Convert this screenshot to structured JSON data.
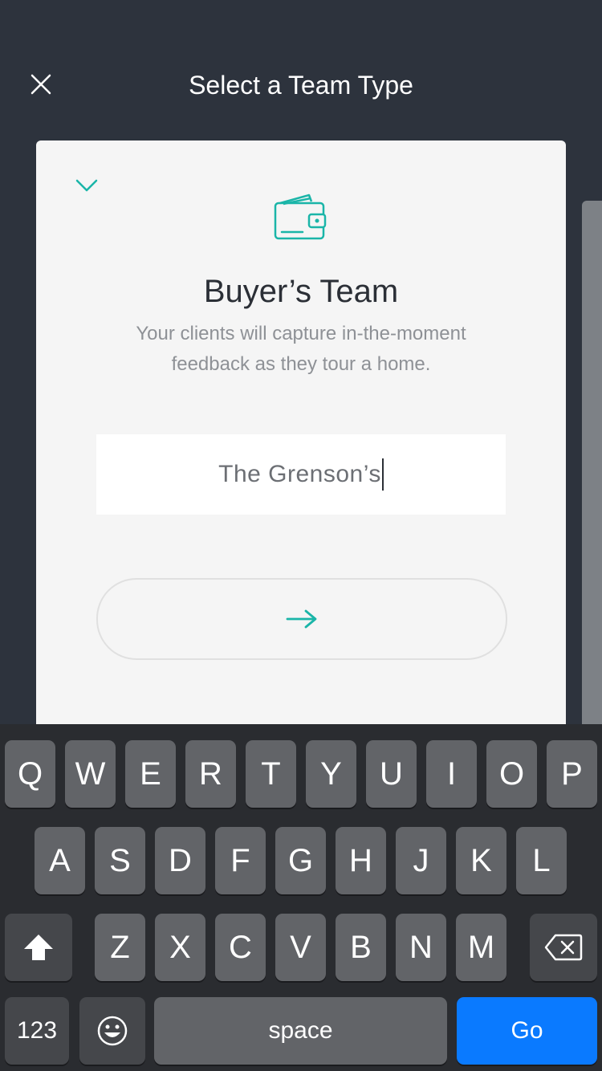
{
  "header": {
    "title": "Select a Team Type"
  },
  "card": {
    "title": "Buyer’s Team",
    "description": "Your clients will capture in-the-moment feedback as they tour a home.",
    "name_input_value": "The Grenson’s",
    "accent_color": "#1ab5a8"
  },
  "keyboard": {
    "row1": [
      "Q",
      "W",
      "E",
      "R",
      "T",
      "Y",
      "U",
      "I",
      "O",
      "P"
    ],
    "row2": [
      "A",
      "S",
      "D",
      "F",
      "G",
      "H",
      "J",
      "K",
      "L"
    ],
    "row3": [
      "Z",
      "X",
      "C",
      "V",
      "B",
      "N",
      "M"
    ],
    "numbers_label": "123",
    "space_label": "space",
    "go_label": "Go",
    "go_color": "#0a7aff"
  },
  "icons": {
    "close": "close-icon",
    "collapse": "chevron-down-icon",
    "team_type": "wallet-icon",
    "next": "arrow-right-icon",
    "shift": "shift-icon",
    "backspace": "backspace-icon",
    "emoji": "emoji-icon"
  }
}
